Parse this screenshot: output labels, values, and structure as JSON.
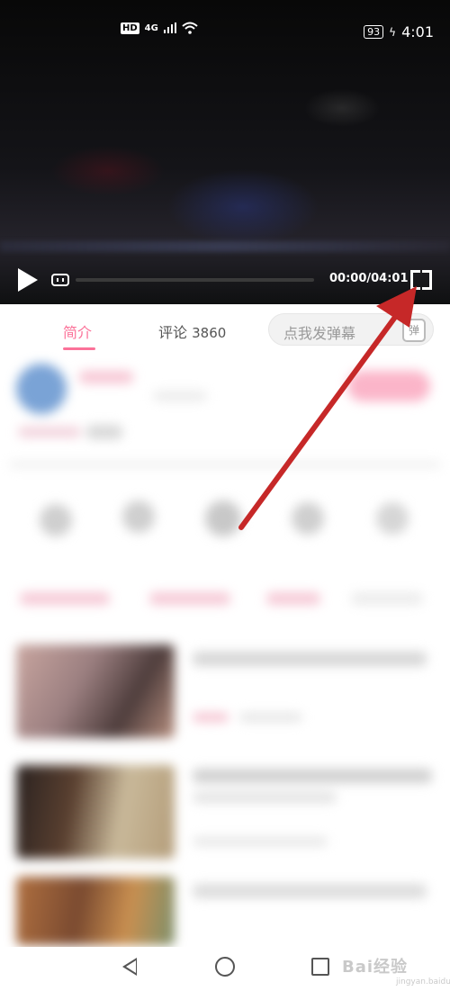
{
  "status_bar": {
    "hd_badge": "HD",
    "network": "4G",
    "battery": "93",
    "time": "4:01"
  },
  "player": {
    "timecode": "00:00/04:01",
    "progress": 0.0
  },
  "tabs": {
    "intro_label": "简介",
    "comments_label": "评论",
    "comments_count": "3860"
  },
  "danmaku": {
    "placeholder": "点我发弹幕",
    "send_label": "弹"
  },
  "watermark": {
    "main": "Bai经验",
    "sub": "jingyan.baidu.com"
  },
  "colors": {
    "accent": "#fb7299",
    "annotation_arrow": "#c62828"
  },
  "icons": [
    "play-icon",
    "danmaku-toggle-icon",
    "fullscreen-icon",
    "back-icon",
    "home-icon",
    "recent-apps-icon",
    "wifi-icon",
    "signal-icon"
  ]
}
